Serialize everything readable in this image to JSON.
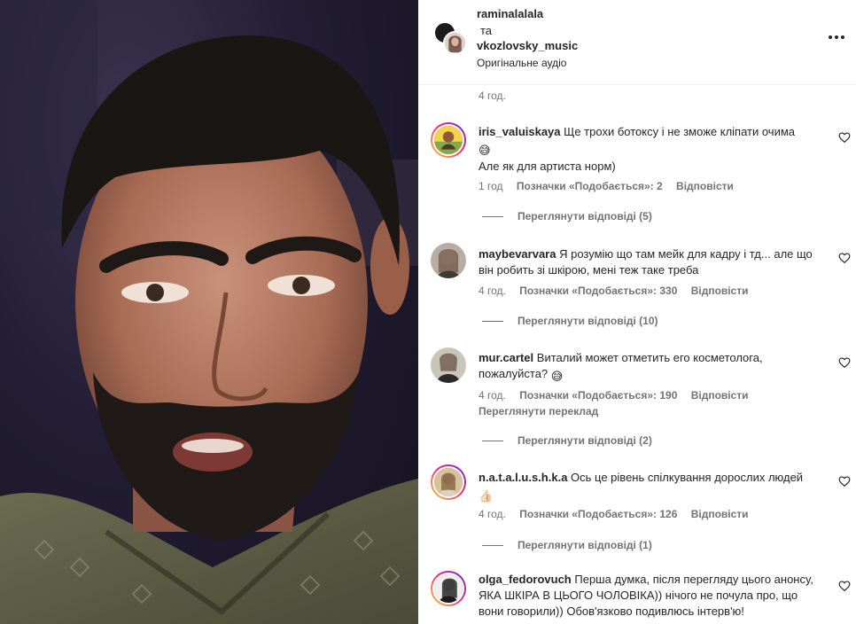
{
  "post": {
    "author1": "raminalalala",
    "conjunction": "та",
    "author2": "vkozlovsky_music",
    "audio": "Оригінальне аудіо",
    "time": "4 год."
  },
  "comments": [
    {
      "user": "iris_valuiskaya",
      "text": "Ще трохи ботоксу і не зможе кліпати очима",
      "emoji": "😅",
      "text2": "Але як для артиста норм)",
      "time": "1 год",
      "likes": "Позначки «Подобається»: 2",
      "reply": "Відповісти",
      "view_replies": "Переглянути відповіді (5)"
    },
    {
      "user": "maybevarvara",
      "text": "Я розумію що там мейк для кадру і тд... але що він робить зі шкірою, мені теж таке треба",
      "time": "4 год.",
      "likes": "Позначки «Подобається»: 330",
      "reply": "Відповісти",
      "view_replies": "Переглянути відповіді (10)"
    },
    {
      "user": "mur.cartel",
      "text": "Виталий может отметить его косметолога, пожалуйста?",
      "emoji": "😅",
      "time": "4 год.",
      "likes": "Позначки «Подобається»: 190",
      "reply": "Відповісти",
      "translate": "Переглянути переклад",
      "view_replies": "Переглянути відповіді (2)"
    },
    {
      "user": "n.a.t.a.l.u.s.h.k.a",
      "text": "Ось це рівень спілкування дорослих людей",
      "emoji": "👍🏻",
      "time": "4 год.",
      "likes": "Позначки «Подобається»: 126",
      "reply": "Відповісти",
      "view_replies": "Переглянути відповіді (1)"
    },
    {
      "user": "olga_fedorovuch",
      "text": "Перша думка, після перегляду цього анонсу, ЯКА ШКІРА В ЦЬОГО ЧОЛОВІКА)) нічого не почула про, що вони говорили)) Обов'язково подивлюсь інтерв'ю!"
    }
  ],
  "icons": {
    "heart": "heart-outline-icon",
    "more": "more-horizontal-icon"
  },
  "colors": {
    "text": "#262626",
    "secondary": "#737373",
    "divider": "#efefef"
  }
}
